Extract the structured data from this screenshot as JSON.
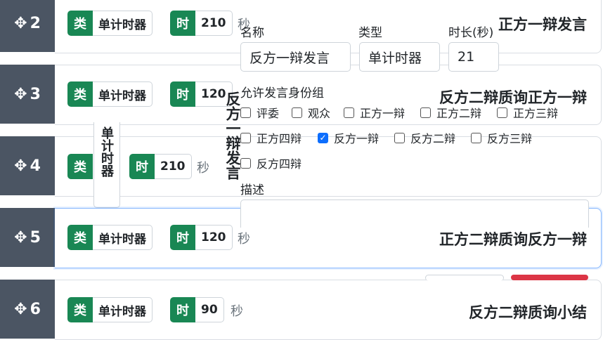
{
  "rows": [
    {
      "index": "2",
      "type_tag": "类",
      "type_value": "单计时器",
      "time_tag": "时",
      "time_value": "210",
      "unit": "秒",
      "title": "正方一辩发言"
    },
    {
      "index": "3",
      "type_tag": "类",
      "type_value": "单计时器",
      "time_tag": "时",
      "time_value": "120",
      "unit": "秒",
      "title": "反方二辩质询正方一辩"
    },
    {
      "index": "4",
      "type_tag": "类",
      "type_value": "单计时器",
      "time_tag": "时",
      "time_value": "210",
      "unit": "秒",
      "title": "反方一辩发言"
    },
    {
      "index": "5",
      "type_tag": "类",
      "type_value": "单计时器",
      "time_tag": "时",
      "time_value": "120",
      "unit": "秒",
      "title": "正方二辩质询反方一辩"
    },
    {
      "index": "6",
      "type_tag": "类",
      "type_value": "单计时器",
      "time_tag": "时",
      "time_value": "90",
      "unit": "秒",
      "title": "反方二辩质询小结"
    }
  ],
  "editor": {
    "name_label": "名称",
    "name_value": "反方一辩发言",
    "type_label": "类型",
    "type_value": "单计时器",
    "duration_label": "时长(秒)",
    "duration_value": "21",
    "roles_label": "允许发言身份组",
    "roles": [
      {
        "label": "评委",
        "checked": false
      },
      {
        "label": "观众",
        "checked": false
      },
      {
        "label": "正方一辩",
        "checked": false
      },
      {
        "label": "正方二辩",
        "checked": false
      },
      {
        "label": "正方三辩",
        "checked": false
      },
      {
        "label": "正方四辩",
        "checked": false
      },
      {
        "label": "反方一辩",
        "checked": true
      },
      {
        "label": "反方二辩",
        "checked": false
      },
      {
        "label": "反方三辩",
        "checked": false
      },
      {
        "label": "反方四辩",
        "checked": false
      }
    ],
    "description_label": "描述"
  },
  "icons": {
    "drag": "move-icon"
  },
  "colors": {
    "tag_green": "#198754",
    "handle": "#4b5563",
    "delete": "#dc3545",
    "checkbox": "#0d6efd"
  }
}
